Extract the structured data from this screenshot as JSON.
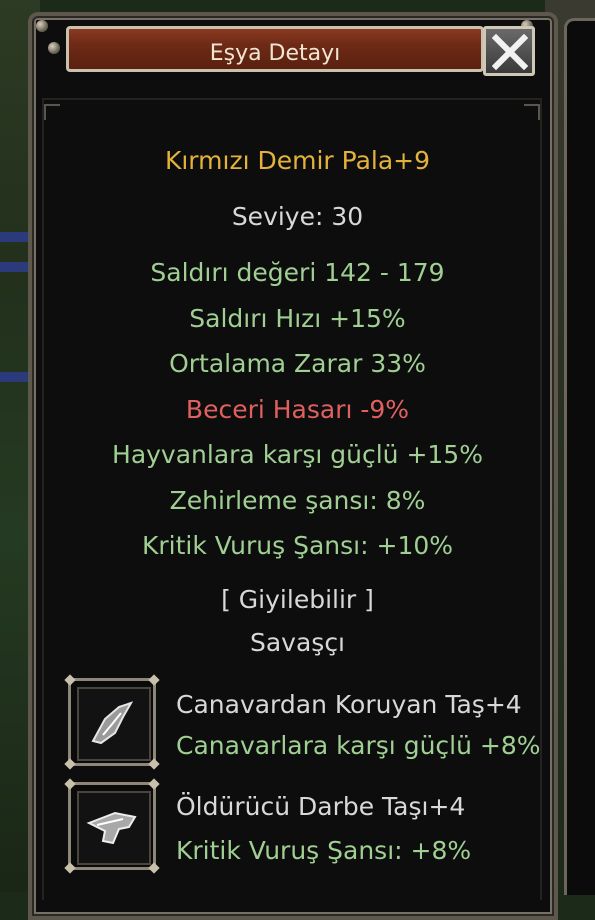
{
  "window": {
    "title": "Eşya Detayı"
  },
  "item": {
    "name": "Kırmızı Demir Pala+9",
    "level": "Seviye: 30",
    "stats": [
      {
        "text": "Saldırı değeri 142 - 179",
        "color": "#9fcf93"
      },
      {
        "text": "Saldırı Hızı +15%",
        "color": "#9fcf93"
      },
      {
        "text": "Ortalama Zarar 33%",
        "color": "#9fcf93"
      },
      {
        "text": "Beceri Hasarı -9%",
        "color": "#e06060"
      },
      {
        "text": "Hayvanlara karşı güçlü +15%",
        "color": "#9fcf93"
      },
      {
        "text": "Zehirleme şansı: 8%",
        "color": "#9fcf93"
      },
      {
        "text": "Kritik Vuruş Şansı: +10%",
        "color": "#9fcf93"
      }
    ],
    "wearable": "[ Giyilebilir ]",
    "class": "Savaşçı"
  },
  "stones": [
    {
      "name": "Canavardan Koruyan Taş+4",
      "bonus": "Canavarlara karşı güçlü +8%",
      "icon": "stone-icon"
    },
    {
      "name": "Öldürücü Darbe Taşı+4",
      "bonus": "Kritik Vuruş Şansı: +8%",
      "icon": "stone-icon"
    }
  ]
}
